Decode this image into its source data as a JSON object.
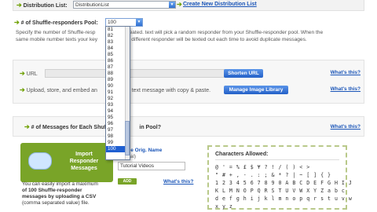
{
  "top": {
    "distribution_label": "Distribution List:",
    "distribution_value": "DistributionList",
    "create_link": "Create New Distribution List"
  },
  "pool": {
    "label": "# of Shuffle-responders Pool:",
    "selected": "100"
  },
  "help": {
    "line1": "Specify the number of Shuffle-resp",
    "line1b": "created. text will pick a random responder from your Shuffle-responder pool. When the",
    "line2": "same mobile number texts your key",
    "line2b": "a different responder will be texted out each time to avoid duplicate messages."
  },
  "url_panel": {
    "url_label": "URL",
    "shorten_button": "Shorten URL",
    "upload_label": "Upload, store, and embed an",
    "upload_label_b": "a text message with copy & paste.",
    "manage_button": "Manage Image Library",
    "whats_this": "What's this?"
  },
  "messages_panel": {
    "label": "# of Messages for Each Shuffle-",
    "label_b": "in Pool?",
    "whats_this": "What's this?"
  },
  "import": {
    "title_lines": [
      "Import",
      "Responder",
      "Messages"
    ],
    "desc_a": "You can easily import a maximum",
    "desc_b": "of 100 Shuffle-responder",
    "desc_c": "messages by uploading a CSV",
    "desc_d": "(comma separated value) file."
  },
  "tag": {
    "header": "Change Orig. Name",
    "header_sub": "(optional)",
    "input_value": "Tutorial Videos",
    "add_button": "ADD",
    "whats_this": "What's this?"
  },
  "chars": {
    "title": "Characters Allowed:",
    "rows": [
      "@ ' = % £ $ ¥ ? ! / ( ) < >",
      "\" # + , - . : ; & * ? | ~ [ ] { }",
      "1 2 3 4 5 6 7 8 9 0 A B C D E F G H I J",
      "K L M N O P Q R S T U V W X Y Z a b c",
      "d e f g h i j k l m n o p q r s t u v w",
      "x y z"
    ]
  },
  "dropdown": {
    "options": [
      "81",
      "82",
      "83",
      "84",
      "85",
      "86",
      "87",
      "88",
      "89",
      "90",
      "91",
      "92",
      "93",
      "94",
      "95",
      "96",
      "97",
      "98",
      "99",
      "100"
    ],
    "selected_index": 19
  },
  "colors": {
    "accent_green": "#79a428",
    "link_blue": "#1a55b8",
    "select_blue": "#1f5fd1"
  }
}
